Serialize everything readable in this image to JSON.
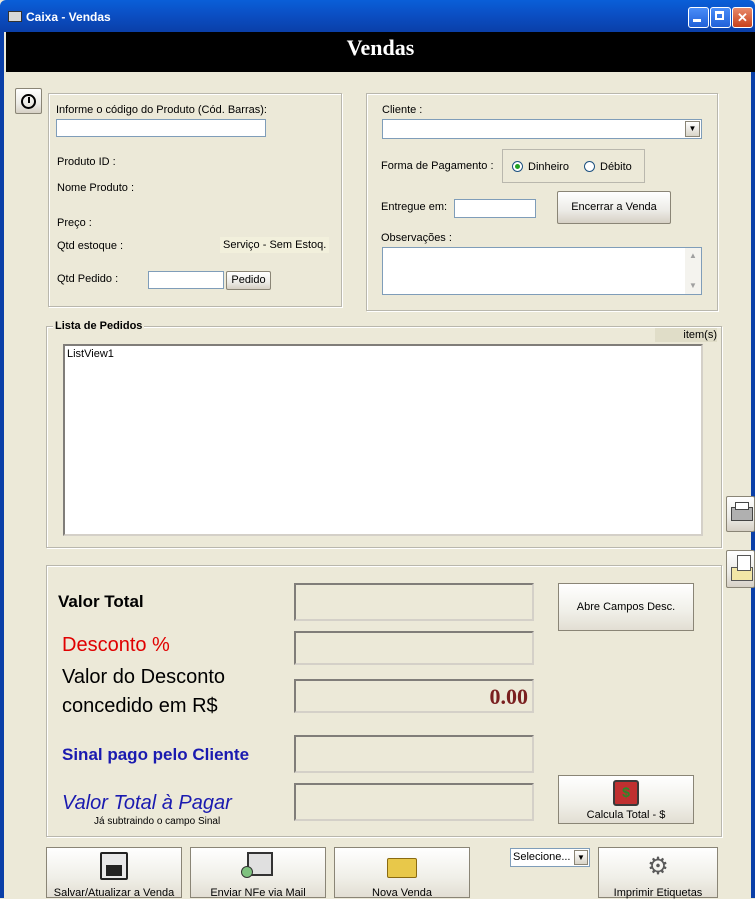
{
  "window": {
    "title": "Caixa - Vendas"
  },
  "header": {
    "title": "Vendas"
  },
  "product": {
    "barcode_label": "Informe o código do Produto (Cód. Barras):",
    "produto_id_label": "Produto ID  :",
    "nome_label": "Nome Produto  :",
    "preco_label": "Preço :",
    "estoque_label": "Qtd estoque :",
    "estoque_note": "Serviço - Sem Estoq.",
    "qtd_pedido_label": "Qtd Pedido :",
    "pedido_button": "Pedido"
  },
  "client": {
    "cliente_label": "Cliente :",
    "pagamento_label": "Forma de Pagamento :",
    "dinheiro": "Dinheiro",
    "debito": "Débito",
    "entregue_label": "Entregue em:",
    "encerrar_button": "Encerrar a Venda",
    "observacoes_label": "Observações :"
  },
  "orders": {
    "title": "Lista de Pedidos",
    "items_label": "item(s)",
    "listview_text": "ListView1"
  },
  "totals": {
    "valor_total": "Valor Total",
    "desconto": "Desconto  %",
    "valor_desconto_line1": "Valor do Desconto",
    "valor_desconto_line2": "concedido em R$",
    "desconto_value": "0.00",
    "sinal": "Sinal pago pelo Cliente",
    "valor_pagar": "Valor Total à Pagar",
    "subtraindo": "Já subtraindo o campo Sinal",
    "abre_campos_button": "Abre Campos Desc.",
    "calcula_button": "Calcula Total - $"
  },
  "toolbar": {
    "salvar": "Salvar/Atualizar a Venda",
    "enviar": "Enviar NFe via Mail",
    "nova": "Nova Venda",
    "selecione": "Selecione...",
    "imprimir": "Imprimir Etiquetas"
  },
  "colors": {
    "accent_red": "#E00000",
    "accent_blue": "#1A1AB0",
    "value_maroon": "#7A2020"
  }
}
